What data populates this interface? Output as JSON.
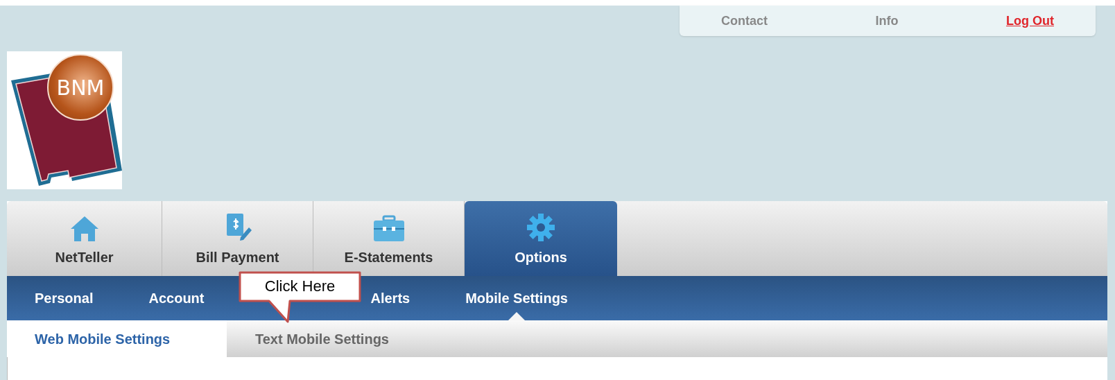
{
  "top_links": [
    {
      "label": "Contact",
      "kind": "plain"
    },
    {
      "label": "Info",
      "kind": "plain"
    },
    {
      "label": "Log Out",
      "kind": "alert"
    }
  ],
  "logo": {
    "text": "BNM"
  },
  "main_tabs": [
    {
      "label": "NetTeller",
      "selected": false
    },
    {
      "label": "Bill Payment",
      "selected": false
    },
    {
      "label": "E-Statements",
      "selected": false
    },
    {
      "label": "Options",
      "selected": true
    }
  ],
  "nav": [
    {
      "label": "Personal",
      "selected": false
    },
    {
      "label": "Account",
      "selected": false
    },
    {
      "label": "Alerts",
      "selected": false
    },
    {
      "label": "Mobile Settings",
      "selected": true
    }
  ],
  "sub_tabs": [
    {
      "label": "Web Mobile Settings",
      "selected": true
    },
    {
      "label": "Text Mobile Settings",
      "selected": false
    }
  ],
  "callout": {
    "text": "Click Here"
  }
}
